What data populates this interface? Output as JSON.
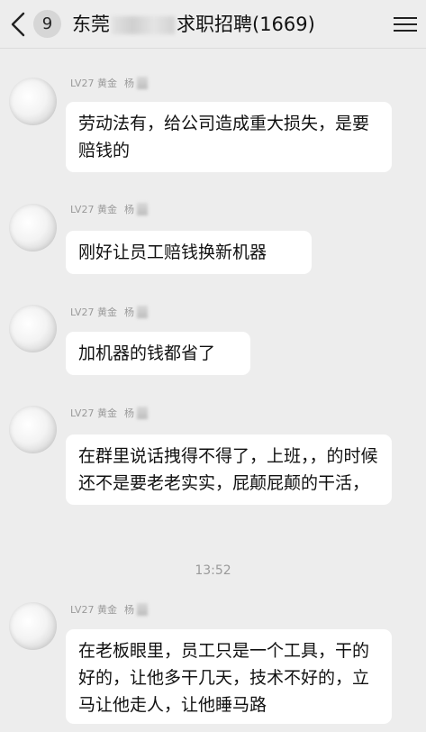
{
  "header": {
    "back_label": "<",
    "unread_count": "9",
    "title_prefix": "东莞",
    "title_suffix": "求职招聘(1669)",
    "menu_icon": "hamburger-icon"
  },
  "messages": [
    {
      "level": "LV27 黄金",
      "name": "杨",
      "text": "劳动法有，给公司造成重大损失，是要赔钱的"
    },
    {
      "level": "LV27 黄金",
      "name": "杨",
      "text": "刚好让员工赔钱换新机器"
    },
    {
      "level": "LV27 黄金",
      "name": "杨",
      "text": "加机器的钱都省了"
    },
    {
      "level": "LV27 黄金",
      "name": "杨",
      "text": "在群里说话拽得不得了，上班，，的时候还不是要老老实实，屁颠屁颠的干活，"
    },
    {
      "level": "LV27 黄金",
      "name": "杨",
      "text": "在老板眼里，员工只是一个工具，干的好的，让他多干几天，技术不好的，立马让他走人，让他睡马路"
    }
  ],
  "timestamp": "13:52"
}
